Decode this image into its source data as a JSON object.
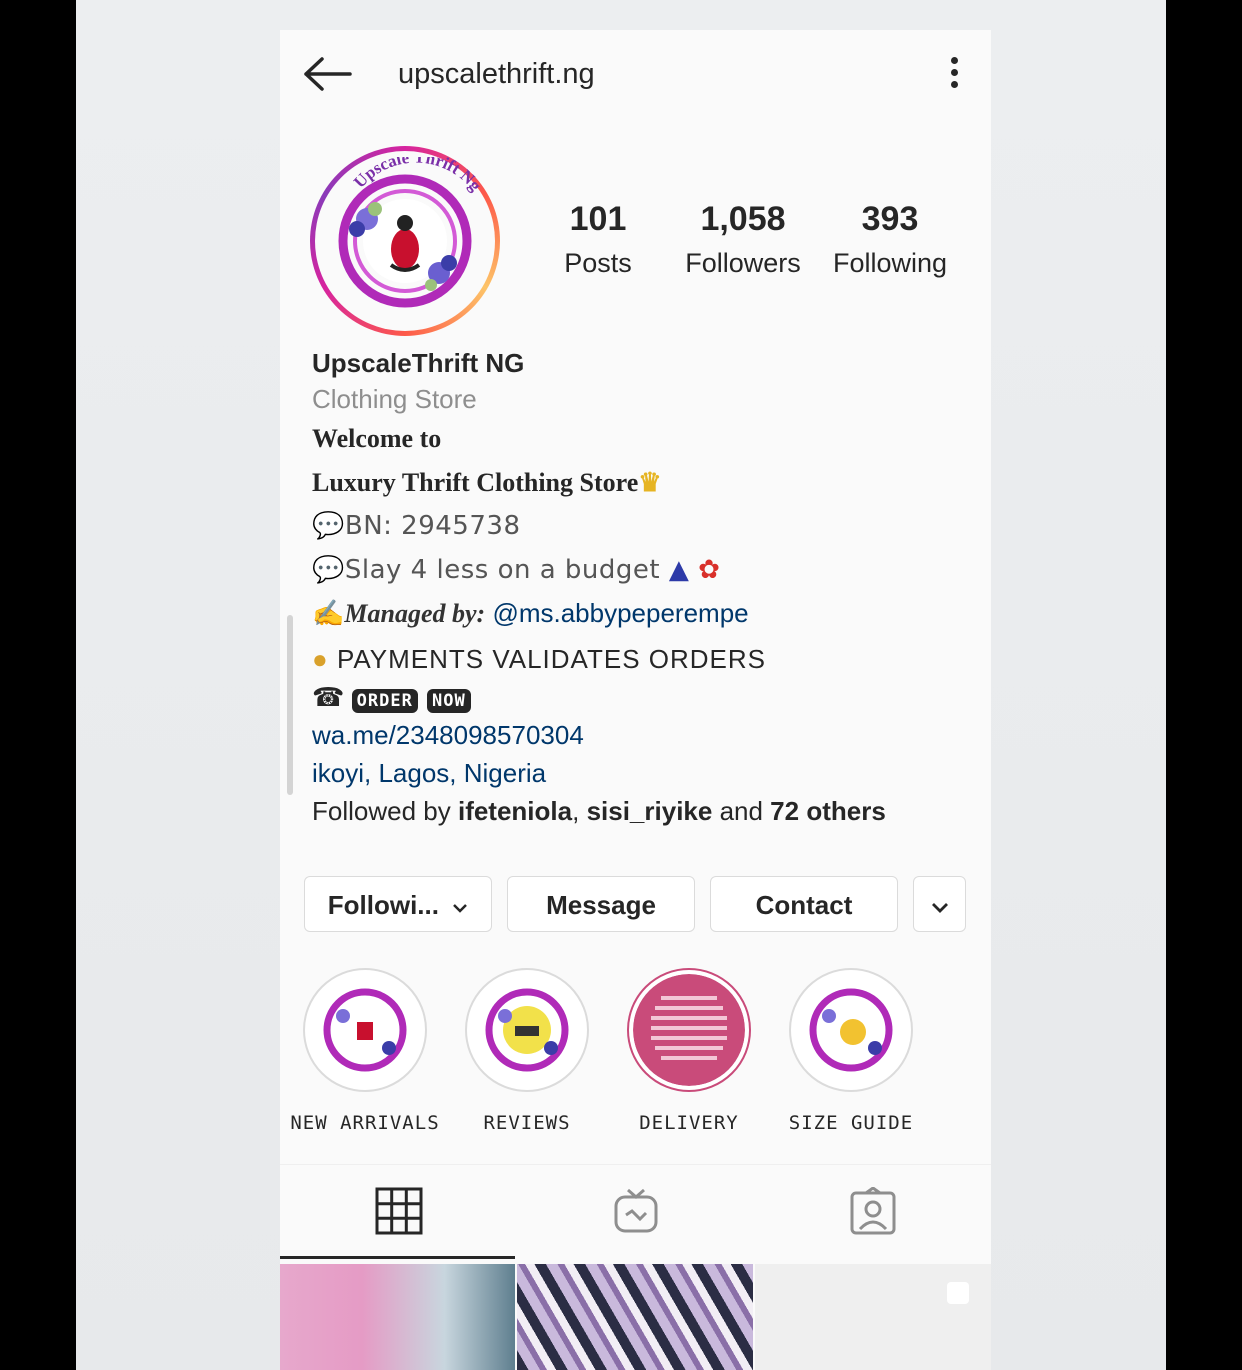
{
  "header": {
    "username": "upscalethrift.ng"
  },
  "avatar": {
    "logo_text": "Upscale Thrift Ng"
  },
  "stats": [
    {
      "value": "101",
      "label": "Posts"
    },
    {
      "value": "1,058",
      "label": "Followers"
    },
    {
      "value": "393",
      "label": "Following"
    }
  ],
  "bio": {
    "name": "UpscaleThrift NG",
    "category": "Clothing Store",
    "welcome": "Welcome to",
    "store_line": "Luxury Thrift Clothing Store",
    "bn": "BN: 2945738",
    "slay": "Slay 4 less on a budget",
    "managed_prefix": "Managed by:",
    "managed_handle": "@ms.abbypeperempe",
    "payments": "PAYMENTS VALIDATES ORDERS",
    "order_word": "ORDER",
    "now_word": "NOW",
    "link": "wa.me/2348098570304",
    "location": "ikoyi, Lagos, Nigeria",
    "followed_prefix": "Followed by ",
    "followed_user1": "ifeteniola",
    "followed_sep": ", ",
    "followed_user2": "sisi_riyike",
    "followed_and": " and ",
    "followed_others": "72 others"
  },
  "buttons": {
    "following": "Followi...",
    "message": "Message",
    "contact": "Contact"
  },
  "highlights": [
    {
      "label": "NEW ARRIVALS"
    },
    {
      "label": "REVIEWS"
    },
    {
      "label": "DELIVERY"
    },
    {
      "label": "SIZE GUIDE"
    }
  ],
  "tabs": [
    "grid-icon",
    "igtv-icon",
    "tagged-icon"
  ],
  "colors": {
    "link": "#00376b",
    "category": "#8e8e8e",
    "ring_accent": "#d6249f",
    "delivery_pink": "#c94b7a"
  }
}
